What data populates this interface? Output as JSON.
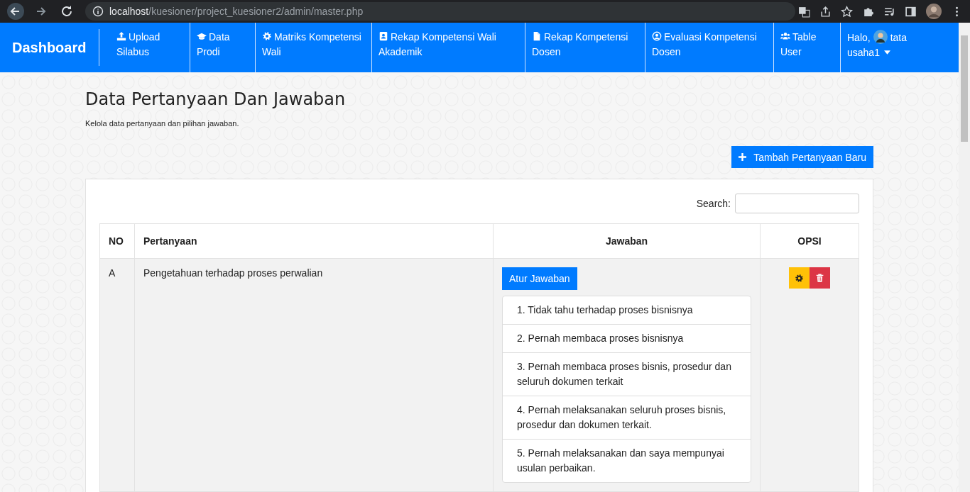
{
  "browser": {
    "url_host": "localhost",
    "url_path": "/kuesioner/project_kuesioner2/admin/master.php"
  },
  "navbar": {
    "brand": "Dashboard",
    "items": [
      {
        "label": "Upload Silabus"
      },
      {
        "label": "Data Prodi"
      },
      {
        "label": "Matriks Kompetensi Wali"
      },
      {
        "label": "Rekap Kompetensi Wali Akademik"
      },
      {
        "label": "Rekap Kompetensi Dosen"
      },
      {
        "label": "Evaluasi Kompetensi Dosen"
      },
      {
        "label": "Table User"
      }
    ],
    "user": {
      "greeting": "Halo,",
      "name": "tata usaha1"
    }
  },
  "page": {
    "title": "Data Pertanyaan Dan Jawaban",
    "subtitle": "Kelola data pertanyaan dan pilihan jawaban.",
    "add_button": "Tambah Pertanyaan Baru"
  },
  "table": {
    "search_label": "Search:",
    "columns": [
      "NO",
      "Pertanyaan",
      "Jawaban",
      "OPSI"
    ],
    "rows": [
      {
        "no": "A",
        "question": "Pengetahuan terhadap proses perwalian",
        "answer_button": "Atur Jawaban",
        "answers": [
          "1. Tidak tahu terhadap proses bisnisnya",
          "2. Pernah membaca proses bisnisnya",
          "3. Pernah membaca proses bisnis, prosedur dan seluruh dokumen terkait",
          "4. Pernah melaksanakan seluruh proses bisnis, prosedur dan dokumen terkait.",
          "5. Pernah melaksanakan dan saya mempunyai usulan perbaikan."
        ]
      }
    ]
  }
}
